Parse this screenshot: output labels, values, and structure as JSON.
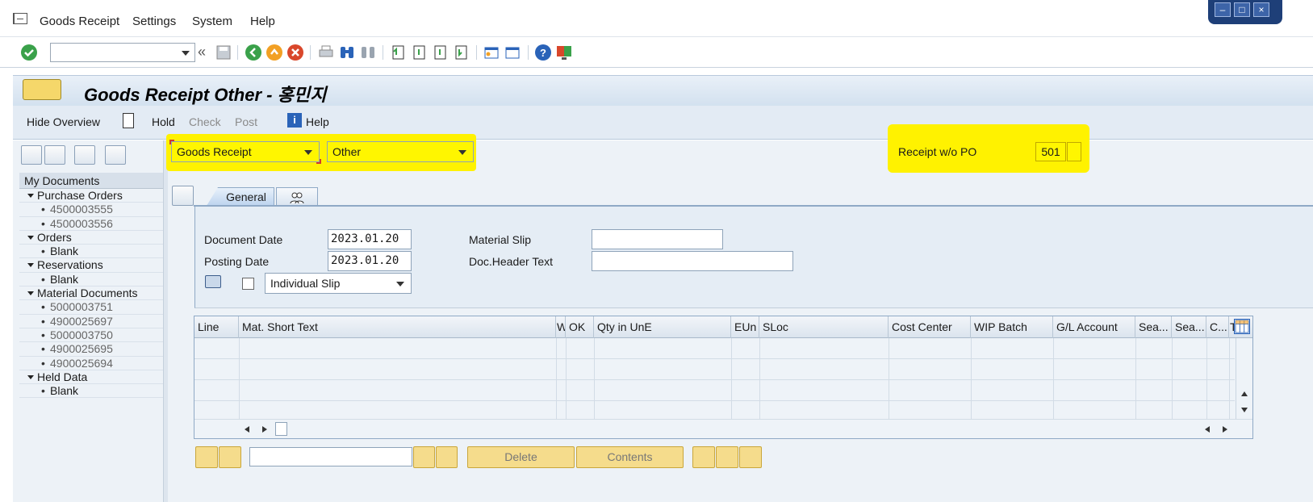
{
  "menu": {
    "items": [
      "Goods Receipt",
      "Settings",
      "System",
      "Help"
    ]
  },
  "toolbar": {
    "command_value": "",
    "nav_label": "«"
  },
  "title": {
    "text": "Goods Receipt Other - 홍민지"
  },
  "app_toolbar": {
    "hide_overview": "Hide Overview",
    "hold": "Hold",
    "check": "Check",
    "post": "Post",
    "help": "Help",
    "help_glyph": "i"
  },
  "header": {
    "action": "Goods Receipt",
    "reference": "Other",
    "receipt_label": "Receipt w/o PO",
    "movement_type": "501"
  },
  "tree": {
    "header": "My Documents",
    "folders": [
      {
        "label": "Purchase Orders",
        "items": [
          "4500003555",
          "4500003556"
        ]
      },
      {
        "label": "Orders",
        "items": [
          "Blank"
        ]
      },
      {
        "label": "Reservations",
        "items": [
          "Blank"
        ]
      },
      {
        "label": "Material Documents",
        "items": [
          "5000003751",
          "4900025697",
          "5000003750",
          "4900025695",
          "4900025694"
        ]
      },
      {
        "label": "Held Data",
        "items": [
          "Blank"
        ]
      }
    ]
  },
  "tabs": {
    "general": "General"
  },
  "form": {
    "document_date_label": "Document Date",
    "document_date": "2023.01.20",
    "posting_date_label": "Posting Date",
    "posting_date": "2023.01.20",
    "slip_option": "Individual Slip",
    "material_slip_label": "Material Slip",
    "material_slip": "",
    "doc_header_label": "Doc.Header Text",
    "doc_header": ""
  },
  "grid": {
    "columns": [
      "Line",
      "Mat. Short Text",
      "W",
      "OK",
      "Qty in UnE",
      "EUn",
      "SLoc",
      "Cost Center",
      "WIP Batch",
      "G/L Account",
      "Sea...",
      "Sea...",
      "C...",
      "T"
    ]
  },
  "bottom": {
    "delete": "Delete",
    "contents": "Contents",
    "search_value": ""
  },
  "colors": {
    "highlight": "#fff200",
    "accent": "#2a63b8"
  }
}
